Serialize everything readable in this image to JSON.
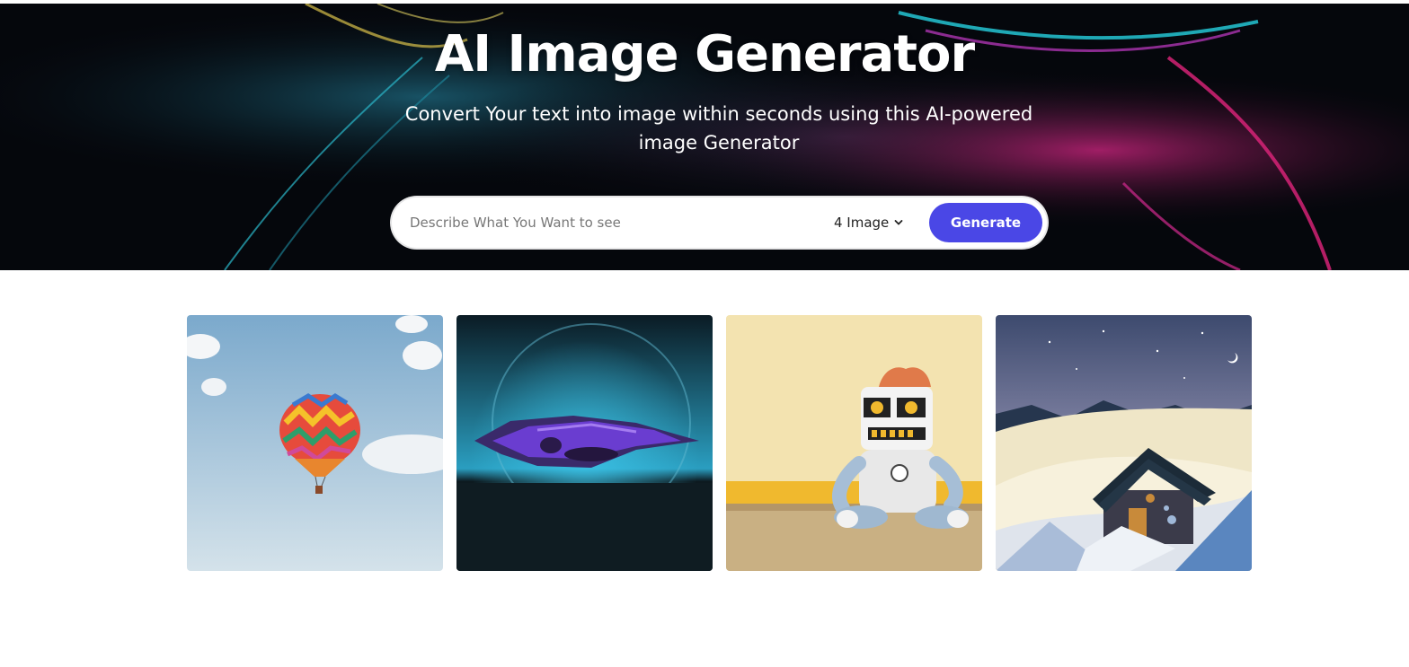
{
  "hero": {
    "title": "AI Image Generator",
    "subtitle": "Convert Your text into image within seconds using this AI-powered image Generator"
  },
  "search": {
    "placeholder": "Describe What You Want to see",
    "value": "",
    "count_selected": "4 Image",
    "generate_label": "Generate"
  },
  "gallery": {
    "images": [
      {
        "name": "hot-air-balloon-image"
      },
      {
        "name": "spaceship-image"
      },
      {
        "name": "plush-robot-image"
      },
      {
        "name": "snowy-cabin-image"
      }
    ]
  },
  "colors": {
    "accent": "#4a47e6",
    "hero_bg": "#05070c"
  }
}
